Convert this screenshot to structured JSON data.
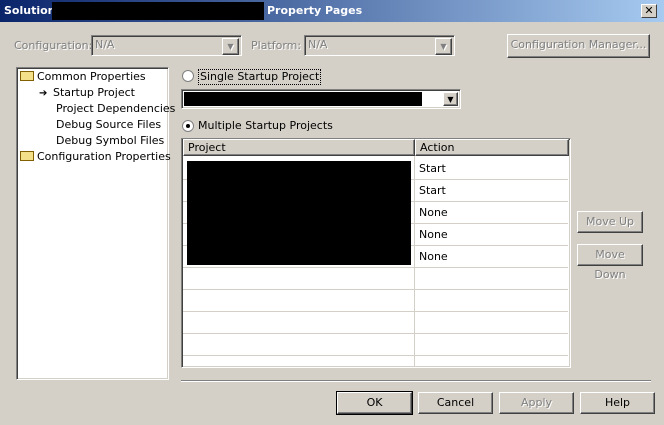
{
  "window": {
    "title_prefix": "Solution",
    "title_suffix": "Property Pages",
    "close_glyph": "✕"
  },
  "toolbar": {
    "configuration_label": "Configuration:",
    "configuration_value": "N/A",
    "platform_label": "Platform:",
    "platform_value": "N/A",
    "config_manager_label": "Configuration Manager..."
  },
  "tree": {
    "items": [
      {
        "label": "Common Properties",
        "icon": "folder-open-icon"
      },
      {
        "label": "Startup Project",
        "icon": "arrow-icon"
      },
      {
        "label": "Project Dependencies"
      },
      {
        "label": "Debug Source Files"
      },
      {
        "label": "Debug Symbol Files"
      },
      {
        "label": "Configuration Properties",
        "icon": "folder-icon"
      }
    ]
  },
  "startup": {
    "single_label": "Single Startup Project",
    "multiple_label": "Multiple Startup Projects",
    "selected": "multiple"
  },
  "grid": {
    "columns": [
      "Project",
      "Action"
    ],
    "actions": [
      "Start",
      "Start",
      "None",
      "None",
      "None"
    ]
  },
  "side_buttons": {
    "move_up": "Move Up",
    "move_down": "Move Down"
  },
  "footer": {
    "ok": "OK",
    "cancel": "Cancel",
    "apply": "Apply",
    "help": "Help"
  },
  "colors": {
    "title_start": "#0a246a",
    "title_end": "#a6caf0",
    "face": "#d4d0c8"
  }
}
